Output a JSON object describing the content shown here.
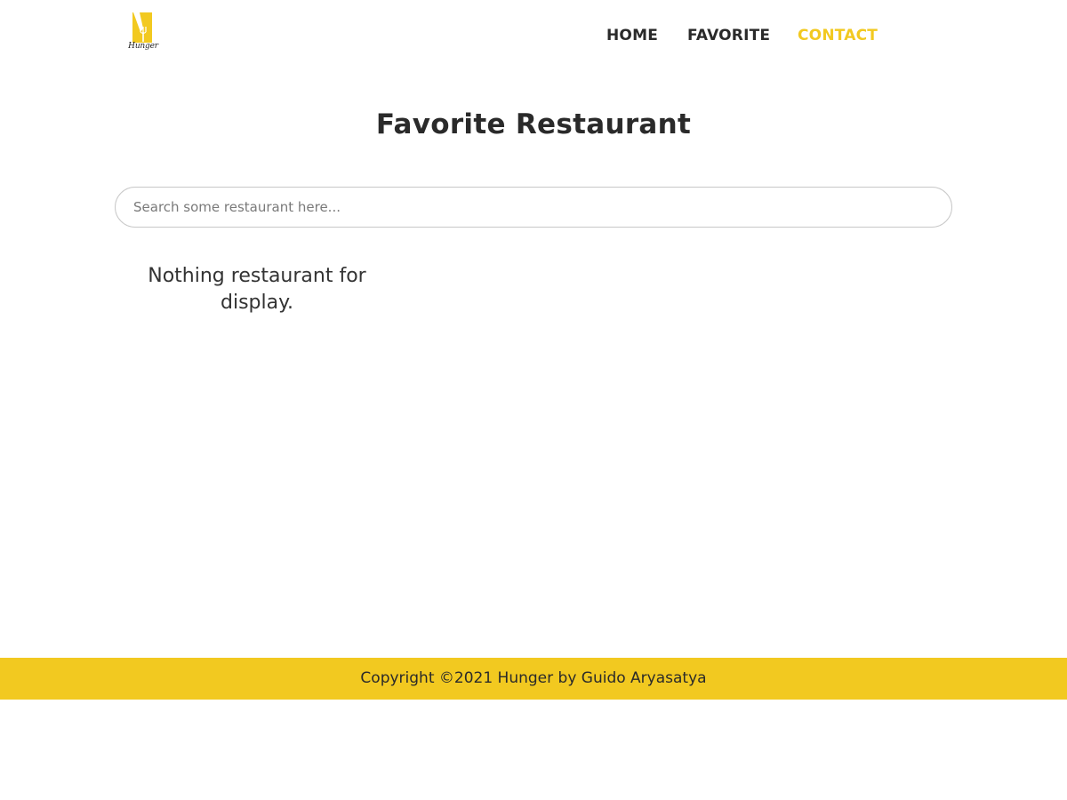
{
  "header": {
    "logo_text": "Hunger",
    "nav": [
      {
        "label": "HOME"
      },
      {
        "label": "FAVORITE"
      },
      {
        "label": "CONTACT"
      }
    ],
    "active_color": "#f2c920"
  },
  "main": {
    "title": "Favorite Restaurant",
    "search": {
      "placeholder": "Search some restaurant here...",
      "value": ""
    },
    "empty_message": "Nothing restaurant for display."
  },
  "footer": {
    "text": "Copyright ©2021 Hunger by Guido Aryasatya",
    "background": "#f2c920"
  }
}
